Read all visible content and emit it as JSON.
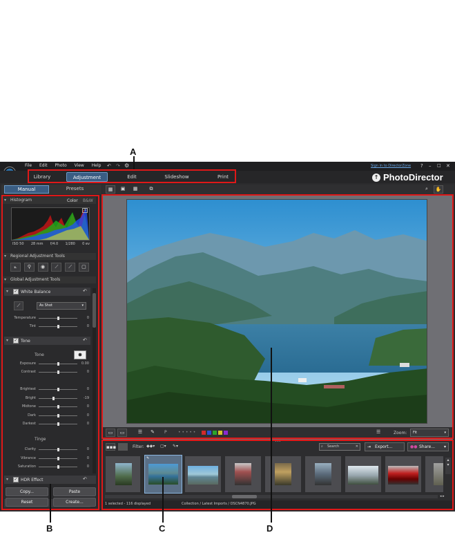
{
  "callouts": {
    "a": "A",
    "b": "B",
    "c": "C",
    "d": "D"
  },
  "menu": [
    "File",
    "Edit",
    "Photo",
    "View",
    "Help"
  ],
  "signin": "Sign in to DirectorZone",
  "window_controls": [
    "?",
    "–",
    "□",
    "✕"
  ],
  "brand": "PhotoDirector",
  "modules": [
    {
      "label": "Library",
      "active": false
    },
    {
      "label": "Adjustment",
      "active": true
    },
    {
      "label": "Edit",
      "active": false
    },
    {
      "label": "Slideshow",
      "active": false
    },
    {
      "label": "Print",
      "active": false
    }
  ],
  "panel_tabs": {
    "manual": "Manual",
    "presets": "Presets"
  },
  "histogram": {
    "title": "Histogram",
    "color": "Color",
    "bw": "B&W",
    "info": [
      "ISO 50",
      "28 mm",
      "f/4.0",
      "1/280",
      "0 ev"
    ]
  },
  "regional": {
    "title": "Regional Adjustment Tools"
  },
  "global": {
    "title": "Global Adjustment Tools"
  },
  "white_balance": {
    "title": "White Balance",
    "preset": "As Shot",
    "sliders": [
      {
        "label": "Temperature",
        "value": "0",
        "pos": 0.5
      },
      {
        "label": "Tint",
        "value": "0",
        "pos": 0.5
      }
    ]
  },
  "tone": {
    "title": "Tone",
    "group_tone": "Tone",
    "sliders1": [
      {
        "label": "Exposure",
        "value": "0.00",
        "pos": 0.5
      },
      {
        "label": "Contrast",
        "value": "0",
        "pos": 0.5
      }
    ],
    "sliders2": [
      {
        "label": "Brightest",
        "value": "0",
        "pos": 0.5
      },
      {
        "label": "Bright",
        "value": "-19",
        "pos": 0.38
      },
      {
        "label": "Midtone",
        "value": "0",
        "pos": 0.5
      },
      {
        "label": "Dark",
        "value": "0",
        "pos": 0.5
      },
      {
        "label": "Darkest",
        "value": "0",
        "pos": 0.5
      }
    ],
    "group_tinge": "Tinge",
    "sliders3": [
      {
        "label": "Clarity",
        "value": "0",
        "pos": 0.5
      },
      {
        "label": "Vibrance",
        "value": "0",
        "pos": 0.5
      },
      {
        "label": "Saturation",
        "value": "0",
        "pos": 0.5
      }
    ]
  },
  "hdr": {
    "title": "HDR Effect"
  },
  "buttons": {
    "copy": "Copy...",
    "paste": "Paste",
    "reset": "Reset",
    "create": "Create..."
  },
  "view": {
    "zoom_label": "Zoom:",
    "zoom_value": "Fit",
    "flag_label": "P",
    "stars": "• • • • •",
    "color_labels": [
      "#d22a2a",
      "#2a4fd2",
      "#2aa52a",
      "#d2c32a",
      "#8a2ad2"
    ]
  },
  "browser": {
    "filter_label": "Filter:",
    "search_placeholder": "Search",
    "export": "Export...",
    "share": "Share..."
  },
  "status": {
    "left": "1 selected - 116 displayed",
    "path": "Collection / Latest Imports / DSCN4870.JPG"
  },
  "colors": {
    "accent": "#3a5d83",
    "callout_red": "#e01818"
  }
}
